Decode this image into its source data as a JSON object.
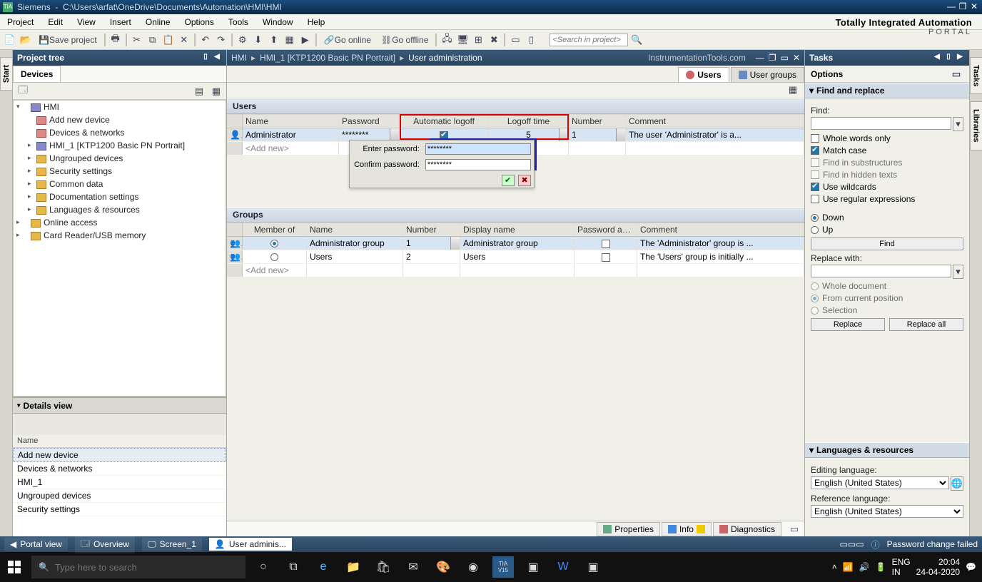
{
  "titlebar": {
    "app": "Siemens",
    "path": "C:\\Users\\arfat\\OneDrive\\Documents\\Automation\\HMI\\HMI"
  },
  "menubar": [
    "Project",
    "Edit",
    "View",
    "Insert",
    "Online",
    "Options",
    "Tools",
    "Window",
    "Help"
  ],
  "brand": {
    "big": "Totally Integrated Automation",
    "small": "PORTAL"
  },
  "toolbar": {
    "save_label": "Save project",
    "go_online": "Go online",
    "go_offline": "Go offline",
    "search_placeholder": "<Search in project>"
  },
  "project_tree": {
    "title": "Project tree",
    "tab": "Devices",
    "items": [
      {
        "exp": "▾",
        "label": "HMI",
        "lvl": 0,
        "ico": "ico-hmi"
      },
      {
        "exp": "",
        "label": "Add new device",
        "lvl": 1,
        "ico": "ico-device"
      },
      {
        "exp": "",
        "label": "Devices & networks",
        "lvl": 1,
        "ico": "ico-device"
      },
      {
        "exp": "▸",
        "label": "HMI_1 [KTP1200 Basic PN Portrait]",
        "lvl": 1,
        "ico": "ico-hmi"
      },
      {
        "exp": "▸",
        "label": "Ungrouped devices",
        "lvl": 1,
        "ico": "ico-folder"
      },
      {
        "exp": "▸",
        "label": "Security settings",
        "lvl": 1,
        "ico": "ico-folder"
      },
      {
        "exp": "▸",
        "label": "Common data",
        "lvl": 1,
        "ico": "ico-folder"
      },
      {
        "exp": "▸",
        "label": "Documentation settings",
        "lvl": 1,
        "ico": "ico-folder"
      },
      {
        "exp": "▸",
        "label": "Languages & resources",
        "lvl": 1,
        "ico": "ico-folder"
      },
      {
        "exp": "▸",
        "label": "Online access",
        "lvl": 0,
        "ico": "ico-folder"
      },
      {
        "exp": "▸",
        "label": "Card Reader/USB memory",
        "lvl": 0,
        "ico": "ico-folder"
      }
    ]
  },
  "details_view": {
    "title": "Details view",
    "head": "Name",
    "rows": [
      "Add new device",
      "Devices & networks",
      "HMI_1",
      "Ungrouped devices",
      "Security settings"
    ]
  },
  "breadcrumb": {
    "parts": [
      "HMI",
      "HMI_1 [KTP1200 Basic PN Portrait]",
      "User administration"
    ],
    "watermark": "InstrumentationTools.com"
  },
  "tabs": {
    "users": "Users",
    "groups": "User groups"
  },
  "users_section": {
    "title": "Users",
    "cols": [
      "Name",
      "Password",
      "Automatic logoff",
      "Logoff time",
      "Number",
      "Comment"
    ],
    "rows": [
      {
        "name": "Administrator",
        "password": "********",
        "auto": true,
        "time": "5",
        "number": "1",
        "comment": "The user 'Administrator' is a..."
      }
    ],
    "addnew": "<Add new>"
  },
  "pwd_popup": {
    "enter": "Enter password:",
    "confirm": "Confirm password:",
    "val": "********"
  },
  "groups_section": {
    "title": "Groups",
    "cols": [
      "Member of",
      "Name",
      "Number",
      "Display name",
      "Password aging",
      "Comment"
    ],
    "rows": [
      {
        "member": true,
        "name": "Administrator group",
        "number": "1",
        "disp": "Administrator group",
        "aging": false,
        "comment": "The 'Administrator' group is ..."
      },
      {
        "member": false,
        "name": "Users",
        "number": "2",
        "disp": "Users",
        "aging": false,
        "comment": "The 'Users' group is initially ..."
      }
    ],
    "addnew": "<Add new>"
  },
  "bottom_tabs": {
    "props": "Properties",
    "info": "Info",
    "diag": "Diagnostics"
  },
  "tasks_panel": {
    "title": "Tasks",
    "options": "Options",
    "find_title": "Find and replace",
    "find_label": "Find:",
    "whole": "Whole words only",
    "match": "Match case",
    "sub": "Find in substructures",
    "hidden": "Find in hidden texts",
    "wild": "Use wildcards",
    "regex": "Use regular expressions",
    "down": "Down",
    "up": "Up",
    "find_btn": "Find",
    "replace_label": "Replace with:",
    "wholedoc": "Whole document",
    "frompos": "From current position",
    "selection": "Selection",
    "replace_btn": "Replace",
    "replaceall_btn": "Replace all",
    "lang_title": "Languages & resources",
    "editing": "Editing language:",
    "reference": "Reference language:",
    "lang_value": "English (United States)"
  },
  "right_rail": [
    "Tasks",
    "Libraries"
  ],
  "left_rail": "Start",
  "statusbar": {
    "portal": "Portal view",
    "overview": "Overview",
    "screen": "Screen_1",
    "useradmin": "User adminis...",
    "msg": "Password change failed"
  },
  "taskbar": {
    "search_placeholder": "Type here to search",
    "lang": "ENG",
    "locale": "IN",
    "time": "20:04",
    "date": "24-04-2020"
  }
}
